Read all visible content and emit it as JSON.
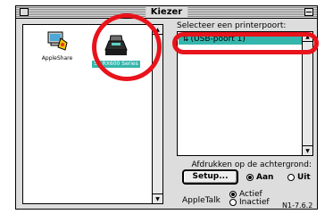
{
  "window": {
    "title": "Kiezer"
  },
  "devices": [
    {
      "name": "AppleShare",
      "icon": "appleshare-icon",
      "selected": false
    },
    {
      "name": "SP RX600 Series",
      "icon": "printer-icon",
      "selected": true
    }
  ],
  "port_panel": {
    "heading": "Selecteer een printerpoort:",
    "ports": [
      {
        "label": "(USB-poort 1)",
        "icon": "usb-icon",
        "selected": true
      }
    ]
  },
  "background_printing": {
    "label": "Afdrukken op de achtergrond:",
    "options": [
      {
        "label": "Aan",
        "selected": true
      },
      {
        "label": "Uit",
        "selected": false
      }
    ]
  },
  "setup_button": "Setup...",
  "appletalk": {
    "label": "AppleTalk",
    "options": [
      {
        "label": "Actief",
        "selected": true
      },
      {
        "label": "Inactief",
        "selected": false
      }
    ]
  },
  "version": "N1-7.6.2",
  "colors": {
    "selection": "#35b6ac",
    "annotation": "#e8131b",
    "window_bg": "#dddddd"
  }
}
